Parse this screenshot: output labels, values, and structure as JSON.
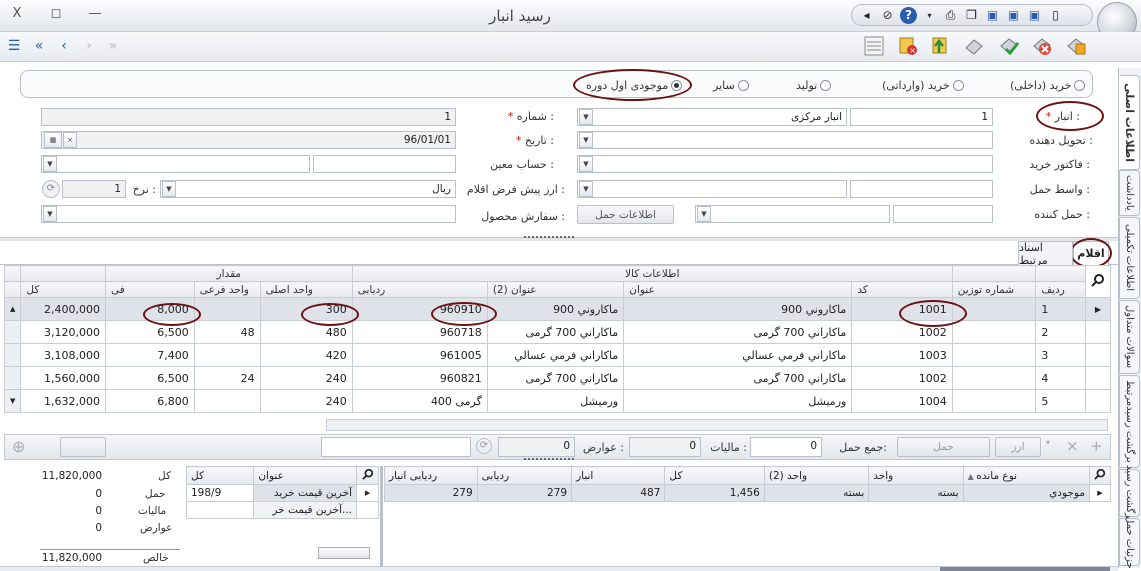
{
  "window": {
    "title": "رسید انبار",
    "close": "X",
    "restore": "◻",
    "minimize": "—"
  },
  "nav": {
    "first": "«",
    "prev": "‹",
    "next": "›",
    "last": "»",
    "menu": "☰"
  },
  "vtabs": [
    "اطلاعات اصلی",
    "یادداشت",
    "اطلاعات تکمیلی",
    "سوالات متداول",
    "برگشت رسیدمرتبط",
    "برگشت رسید",
    "جزئیات حمل"
  ],
  "radios": [
    {
      "label": "خرید (داخلی)",
      "checked": false
    },
    {
      "label": "خرید (وارداتی)",
      "checked": false
    },
    {
      "label": "تولید",
      "checked": false
    },
    {
      "label": "سایر",
      "checked": false
    },
    {
      "label": "موجودی اول دوره",
      "checked": true
    }
  ],
  "form": {
    "warehouse_label": "انبار :",
    "warehouse_code": "1",
    "warehouse_name": "انبار مرکزی",
    "deliverer_label": "تحویل دهنده :",
    "invoice_label": "فاکتور خرید :",
    "carrier_label": "واسط حمل :",
    "shipper_label": "حمل کننده :",
    "number_label": "شماره :",
    "number_value": "1",
    "date_label": "تاریخ :",
    "date_value": "96/01/01",
    "account_label": "حساب معین :",
    "currency_label": "ارز پیش فرض اقلام :",
    "currency_value": "ریال",
    "rate_label": "نرخ :",
    "rate_value": "1",
    "order_label": "سفارش محصول :",
    "shipping_info_button": "اطلاعات حمل"
  },
  "subtabs": {
    "items": "اقلام",
    "related_docs": "اسناد مرتبط"
  },
  "grid": {
    "group_headers": {
      "goods_info": "اطلاعات کالا",
      "quantity": "مقدار"
    },
    "headers": {
      "row": "ردیف",
      "weigh_no": "شماره توزین",
      "code": "کد",
      "title": "عنوان",
      "title2": "عنوان (2)",
      "tracking": "ردیابی",
      "main_unit": "واحد اصلی",
      "sub_unit": "واحد فرعی",
      "price": "فی",
      "total": "کل"
    },
    "rows": [
      {
        "row": "1",
        "weigh": "",
        "code": "1001",
        "title": "ماكاروني 900",
        "title2": "ماكاروني 900",
        "tracking": "960910",
        "main": "300",
        "sub": "",
        "price": "8,000",
        "total": "2,400,000"
      },
      {
        "row": "2",
        "weigh": "",
        "code": "1002",
        "title": "ماكاراني 700 گرمی",
        "title2": "ماكاراني 700 گرمی",
        "tracking": "960718",
        "main": "480",
        "sub": "48",
        "price": "6,500",
        "total": "3,120,000"
      },
      {
        "row": "3",
        "weigh": "",
        "code": "1003",
        "title": "ماكاراني فرمي عسالي",
        "title2": "ماكاراني فرمي عسالي",
        "tracking": "961005",
        "main": "420",
        "sub": "",
        "price": "7,400",
        "total": "3,108,000"
      },
      {
        "row": "4",
        "weigh": "",
        "code": "1002",
        "title": "ماكاراني 700 گرمی",
        "title2": "ماكاراني 700 گرمی",
        "tracking": "960821",
        "main": "240",
        "sub": "24",
        "price": "6,500",
        "total": "1,560,000"
      },
      {
        "row": "5",
        "weigh": "",
        "code": "1004",
        "title": "ورميشل",
        "title2": "ورميشل",
        "tracking": "400 گرمی",
        "main": "240",
        "sub": "",
        "price": "6,800",
        "total": "1,632,000"
      }
    ]
  },
  "footer": {
    "shipping_total_label": "جمع حمل:",
    "shipping_total": "0",
    "tax_label": "ماليات :",
    "tax": "0",
    "duties_label": "عوارض :",
    "duties": "0",
    "currency_btn": "ارز",
    "shipping_btn": "حمل"
  },
  "inventory": {
    "headers": {
      "type": "نوع مانده",
      "unit": "واحد",
      "unit2": "واحد (2)",
      "total": "کل",
      "warehouse": "انبار",
      "tracking": "ردیابی",
      "wh_tracking": "ردیابی انبار"
    },
    "rows": [
      {
        "type": "موجودي",
        "unit": "بسته",
        "unit2": "بسته",
        "total": "1,456",
        "warehouse": "487",
        "tracking": "279",
        "wh_tracking": "279"
      }
    ]
  },
  "price_history": {
    "headers": {
      "title": "عنوان",
      "total": "کل"
    },
    "rows": [
      {
        "title": "آخرين قيمت خريد",
        "total": "198/9"
      },
      {
        "title": "آخرين قيمت خر...",
        "total": ""
      }
    ]
  },
  "summary": [
    {
      "label": "کل",
      "value": "11,820,000"
    },
    {
      "label": "حمل",
      "value": "0"
    },
    {
      "label": "ماليات",
      "value": "0"
    },
    {
      "label": "عوارض",
      "value": "0"
    },
    {
      "label": "خالص",
      "value": "11,820,000"
    }
  ],
  "colors": {
    "highlight": "#6b1212",
    "selected_row": "#dfe3e9",
    "nav_blue": "#2a5db0"
  }
}
